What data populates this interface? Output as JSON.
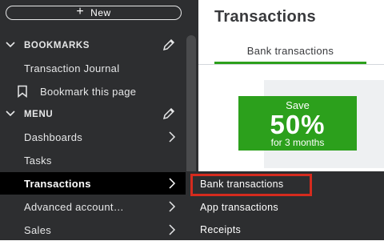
{
  "sidebar": {
    "new_button": "New",
    "bookmarks_header": "BOOKMARKS",
    "bookmarks": [
      {
        "label": "Transaction Journal"
      },
      {
        "label": "Bookmark this page"
      }
    ],
    "menu_header": "MENU",
    "menu_items": [
      {
        "label": "Dashboards",
        "has_arrow": true
      },
      {
        "label": "Tasks",
        "has_arrow": false
      },
      {
        "label": "Transactions",
        "has_arrow": true,
        "active": true
      },
      {
        "label": "Advanced account…",
        "has_arrow": true
      },
      {
        "label": "Sales",
        "has_arrow": true
      }
    ]
  },
  "main": {
    "title": "Transactions",
    "tabs": [
      {
        "label": "Bank transactions",
        "active": true
      }
    ],
    "promo": {
      "line1": "Save",
      "line2": "50%",
      "line3": "for 3 months"
    }
  },
  "flyout": {
    "items": [
      {
        "label": "Bank transactions",
        "highlighted": true
      },
      {
        "label": "App transactions"
      },
      {
        "label": "Receipts"
      }
    ]
  },
  "colors": {
    "sidebar_bg": "#2d2e30",
    "active_bg": "#000000",
    "accent_green": "#2ca01c",
    "highlight_red": "#d52b1e"
  },
  "icons": [
    "plus-icon",
    "chevron-down-icon",
    "pencil-icon",
    "bookmark-icon",
    "chevron-right-icon"
  ]
}
